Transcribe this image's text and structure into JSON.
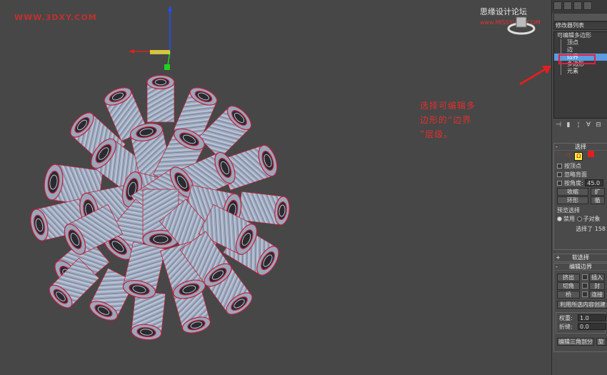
{
  "watermark": {
    "left": "WWW.3DXY.COM",
    "right": "思缘设计论坛",
    "right_url": "www.MISSYUAN.COM"
  },
  "annotation": {
    "line1": "选择可编辑多",
    "line2": "边形的“边界",
    "line3": "”层级。"
  },
  "panel": {
    "modifier_list": "修改器列表",
    "stack": [
      {
        "label": "可编辑多边形",
        "root": true
      },
      {
        "label": "顶点"
      },
      {
        "label": "边"
      },
      {
        "label": "边界",
        "selected": true
      },
      {
        "label": "多边形"
      },
      {
        "label": "元素"
      }
    ],
    "selection": {
      "title": "选择",
      "by_vertex": "按顶点",
      "ignore_backfacing": "忽略背面",
      "by_angle": "按角度:",
      "angle_value": "45.0",
      "shrink": "收缩",
      "ring": "环形",
      "preview_title": "预览选择",
      "disabled": "禁用",
      "subobject": "子对象",
      "selected_info": "选择了 158"
    },
    "soft_selection": {
      "title": "软选择"
    },
    "edit_borders": {
      "title": "编辑边界",
      "extrude": "挤出",
      "chamfer": "切角",
      "bridge": "桥",
      "insert": "插入",
      "cap": "封",
      "connect": "连接",
      "create_shape": "利用所选内容创建",
      "weight_label": "权重:",
      "weight_value": "1.0",
      "crease_label": "折缝:",
      "crease_value": "0.0",
      "edit_tri": "编辑三角剖分"
    }
  },
  "colors": {
    "viewport_bg": "#474747",
    "cylinder": "#a8b4c8",
    "edges": "#c0203a",
    "selected": "#5b9be0"
  }
}
